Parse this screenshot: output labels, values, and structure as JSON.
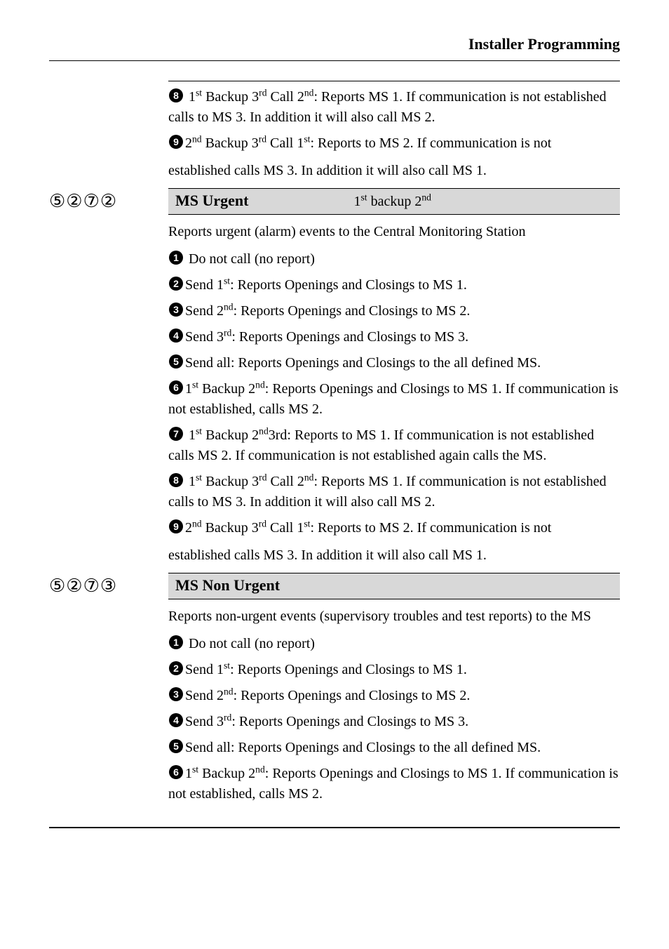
{
  "header": {
    "title": "Installer Programming"
  },
  "prelude": {
    "items": [
      {
        "n": 8,
        "html": " 1<sup>st</sup> Backup 3<sup>rd</sup> Call 2<sup>nd</sup>: Reports MS 1. If communication is not established calls to MS 3. In addition it will also call MS 2."
      },
      {
        "n": 9,
        "html": "2<sup>nd</sup> Backup 3<sup>rd</sup> Call 1<sup>st</sup>: Reports to MS 2. If communication is not"
      }
    ],
    "tail": "established calls MS 3. In addition it will also call MS 1."
  },
  "sections": [
    {
      "code": "⑤②⑦②",
      "title": "MS Urgent",
      "subtitle": "1<sup>st</sup> backup 2<sup>nd</sup>",
      "intro": "Reports urgent (alarm) events to the Central Monitoring Station",
      "items": [
        {
          "n": 1,
          "html": " Do not call (no report)"
        },
        {
          "n": 2,
          "html": "Send 1<sup>st</sup>: Reports Openings and Closings to MS 1."
        },
        {
          "n": 3,
          "html": "Send 2<sup>nd</sup>: Reports Openings and Closings to MS 2."
        },
        {
          "n": 4,
          "html": "Send 3<sup>rd</sup>: Reports Openings and Closings to MS 3."
        },
        {
          "n": 5,
          "html": "Send all: Reports Openings and Closings to the all defined MS."
        },
        {
          "n": 6,
          "html": "1<sup>st</sup> Backup 2<sup>nd</sup>: Reports Openings and Closings to MS 1. If communication is not established, calls MS 2."
        },
        {
          "n": 7,
          "html": " 1<sup>st</sup> Backup 2<sup>nd</sup>3rd: Reports to MS 1. If communication is not established calls MS 2. If communication is not established again calls the MS."
        },
        {
          "n": 8,
          "html": " 1<sup>st</sup> Backup 3<sup>rd</sup> Call 2<sup>nd</sup>: Reports MS 1. If communication is not established calls to MS 3. In addition it will also call MS 2."
        },
        {
          "n": 9,
          "html": "2<sup>nd</sup> Backup 3<sup>rd</sup> Call 1<sup>st</sup>: Reports to MS 2. If communication is not"
        }
      ],
      "tail": "established calls MS 3. In addition it will also call MS 1."
    },
    {
      "code": "⑤②⑦③",
      "title": "MS Non Urgent",
      "subtitle": "",
      "intro": "Reports non-urgent events (supervisory troubles and test reports) to the MS",
      "items": [
        {
          "n": 1,
          "html": " Do not call (no report)"
        },
        {
          "n": 2,
          "html": "Send 1<sup>st</sup>: Reports Openings and Closings to MS 1."
        },
        {
          "n": 3,
          "html": "Send 2<sup>nd</sup>: Reports Openings and Closings to MS 2."
        },
        {
          "n": 4,
          "html": "Send 3<sup>rd</sup>: Reports Openings and Closings to MS 3."
        },
        {
          "n": 5,
          "html": "Send all: Reports Openings and Closings to the all defined MS."
        },
        {
          "n": 6,
          "html": "1<sup>st</sup> Backup 2<sup>nd</sup>: Reports Openings and Closings to MS 1. If communication is not established, calls MS 2."
        }
      ],
      "tail": ""
    }
  ]
}
